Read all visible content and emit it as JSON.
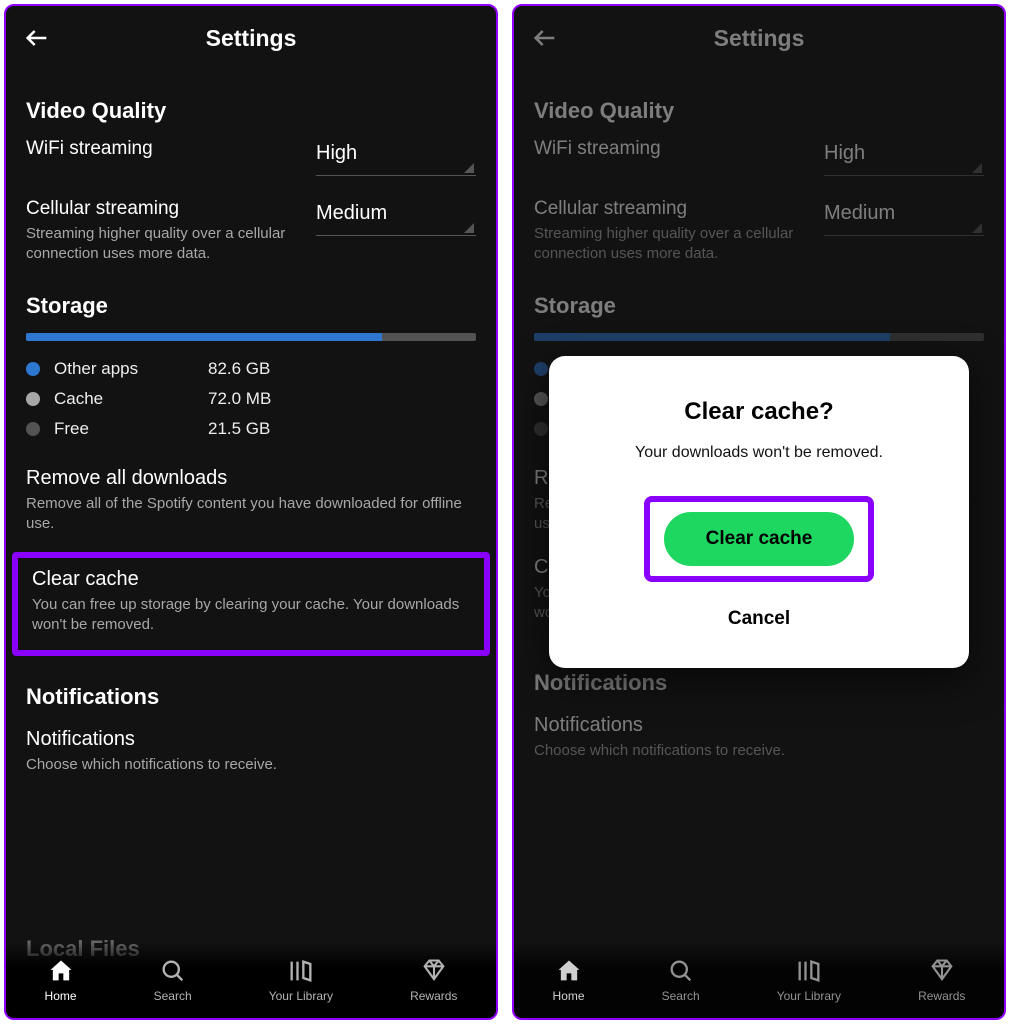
{
  "header": {
    "title": "Settings"
  },
  "video_quality": {
    "heading": "Video Quality",
    "wifi": {
      "label": "WiFi streaming",
      "value": "High"
    },
    "cellular": {
      "label": "Cellular streaming",
      "sub": "Streaming higher quality over a cellular connection uses more data.",
      "value": "Medium"
    }
  },
  "storage": {
    "heading": "Storage",
    "bar_fill_pct": 79,
    "legend": [
      {
        "name": "Other apps",
        "value": "82.6 GB",
        "color": "#2e77d0"
      },
      {
        "name": "Cache",
        "value": "72.0 MB",
        "color": "#a7a7a7"
      },
      {
        "name": "Free",
        "value": "21.5 GB",
        "color": "#535353"
      }
    ],
    "remove_downloads": {
      "title": "Remove all downloads",
      "desc": "Remove all of the Spotify content you have downloaded for offline use."
    },
    "clear_cache": {
      "title": "Clear cache",
      "desc": "You can free up storage by clearing your cache. Your downloads won't be removed."
    }
  },
  "notifications": {
    "heading": "Notifications",
    "title": "Notifications",
    "desc": "Choose which notifications to receive."
  },
  "partial_heading": "Local Files",
  "nav": {
    "home": "Home",
    "search": "Search",
    "library": "Your Library",
    "rewards": "Rewards"
  },
  "dialog": {
    "title": "Clear cache?",
    "body": "Your downloads won't be removed.",
    "confirm": "Clear cache",
    "cancel": "Cancel"
  }
}
